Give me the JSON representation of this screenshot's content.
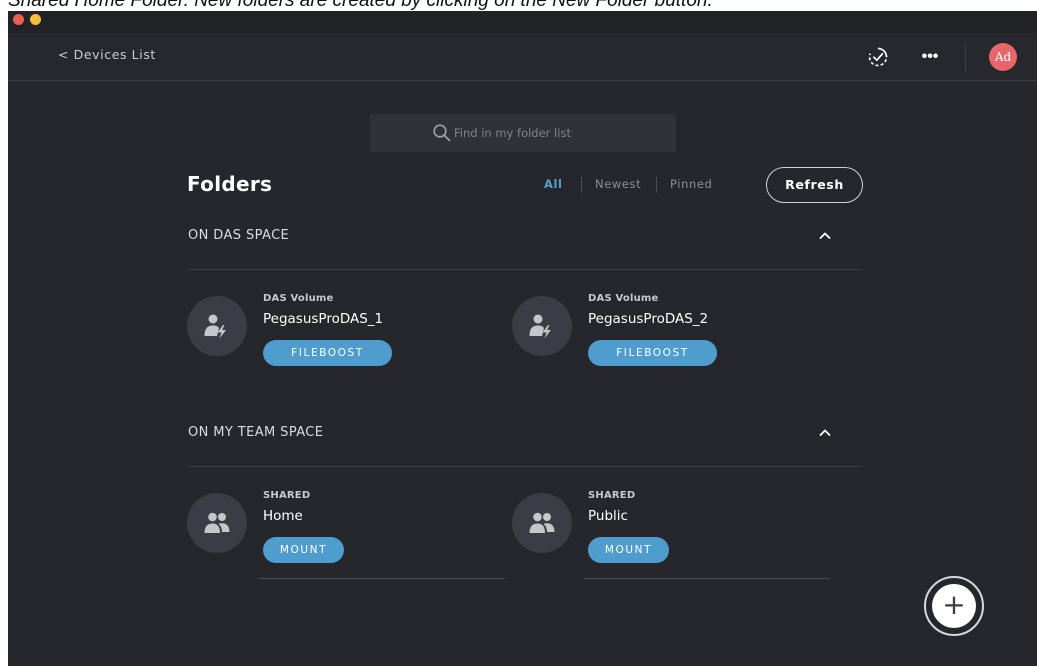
{
  "caption": "Shared Home Folder. New folders are created by clicking on the New Folder button.",
  "nav": {
    "back_label": "< Devices List",
    "more_label": "•••",
    "avatar_initials": "Ad"
  },
  "search": {
    "placeholder": "Find in my folder list"
  },
  "folders": {
    "title": "Folders",
    "filters": [
      "All",
      "Newest",
      "Pinned"
    ],
    "active_filter": "All",
    "refresh_label": "Refresh"
  },
  "sections": [
    {
      "title": "ON DAS SPACE",
      "items": [
        {
          "type": "DAS Volume",
          "name": "PegasusProDAS_1",
          "button": "FILEBOOST",
          "icon": "user-bolt-icon"
        },
        {
          "type": "DAS Volume",
          "name": "PegasusProDAS_2",
          "button": "FILEBOOST",
          "icon": "user-bolt-icon"
        }
      ]
    },
    {
      "title": "ON MY TEAM SPACE",
      "items": [
        {
          "type": "SHARED",
          "name": "Home",
          "button": "MOUNT",
          "icon": "users-icon"
        },
        {
          "type": "SHARED",
          "name": "Public",
          "button": "MOUNT",
          "icon": "users-icon"
        }
      ]
    }
  ],
  "fab": {
    "label": "+"
  },
  "colors": {
    "background": "#25272c",
    "accent": "#4f9ccf",
    "avatar": "#e8666a"
  }
}
